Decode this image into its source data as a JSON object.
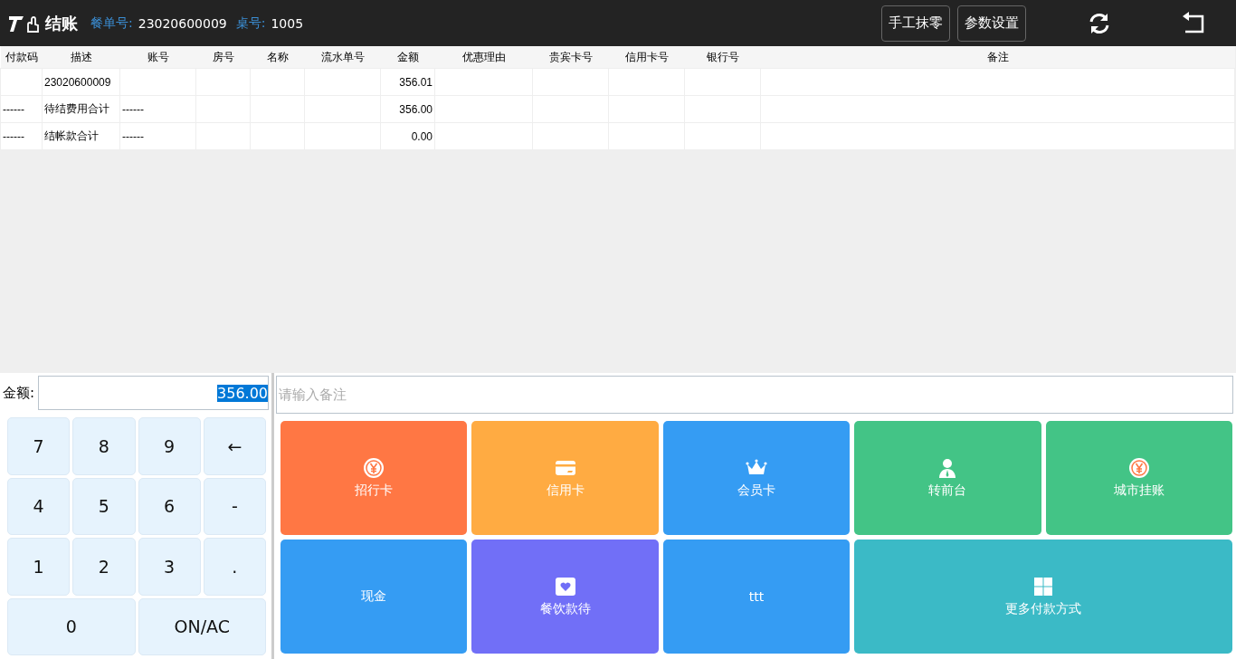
{
  "header": {
    "title": "结账",
    "order_label": "餐单号:",
    "order_no": "23020600009",
    "table_label": "桌号:",
    "table_no": "1005",
    "buttons": [
      "手工抹零",
      "参数设置"
    ]
  },
  "table": {
    "columns": [
      "付款码",
      "描述",
      "账号",
      "房号",
      "名称",
      "流水单号",
      "金额",
      "优惠理由",
      "贵宾卡号",
      "信用卡号",
      "银行号",
      "备注"
    ],
    "rows": [
      [
        "",
        "23020600009",
        "",
        "",
        "",
        "",
        "356.01",
        "",
        "",
        "",
        "",
        ""
      ],
      [
        "------",
        "待结费用合计",
        "------",
        "",
        "",
        "",
        "356.00",
        "",
        "",
        "",
        "",
        ""
      ],
      [
        "------",
        "结帐款合计",
        "------",
        "",
        "",
        "",
        "0.00",
        "",
        "",
        "",
        "",
        ""
      ]
    ]
  },
  "amount": {
    "label": "金额:",
    "value": "356.00",
    "highlighted": true
  },
  "remark": {
    "placeholder": "请输入备注"
  },
  "keypad": [
    {
      "label": "7",
      "kind": "key"
    },
    {
      "label": "8",
      "kind": "key"
    },
    {
      "label": "9",
      "kind": "key"
    },
    {
      "label": "←",
      "kind": "key"
    },
    {
      "label": "4",
      "kind": "key"
    },
    {
      "label": "5",
      "kind": "key"
    },
    {
      "label": "6",
      "kind": "key"
    },
    {
      "label": "-",
      "kind": "key"
    },
    {
      "label": "1",
      "kind": "key"
    },
    {
      "label": "2",
      "kind": "key"
    },
    {
      "label": "3",
      "kind": "key"
    },
    {
      "label": ".",
      "kind": "key"
    },
    {
      "label": "0",
      "kind": "wide"
    },
    {
      "label": "ON/AC",
      "kind": "wide"
    }
  ],
  "payments": [
    {
      "label": "招行卡",
      "kind": "coin",
      "color": "#ff7744",
      "wide": false
    },
    {
      "label": "信用卡",
      "kind": "card",
      "color": "#ffab42",
      "wide": false
    },
    {
      "label": "会员卡",
      "kind": "crown",
      "color": "#359cf3",
      "wide": false
    },
    {
      "label": "转前台",
      "kind": "person",
      "color": "#43c486",
      "wide": false
    },
    {
      "label": "城市挂账",
      "kind": "coin",
      "color": "#43c486",
      "wide": false
    },
    {
      "label": "现金",
      "kind": "plain",
      "color": "#359cf3",
      "wide": false
    },
    {
      "label": "餐饮款待",
      "kind": "heart",
      "color": "#716ff7",
      "wide": false
    },
    {
      "label": "ttt",
      "kind": "plain",
      "color": "#359cf3",
      "wide": false
    },
    {
      "label": "更多付款方式",
      "kind": "grid",
      "color": "#3bbac6",
      "wide": true
    }
  ]
}
